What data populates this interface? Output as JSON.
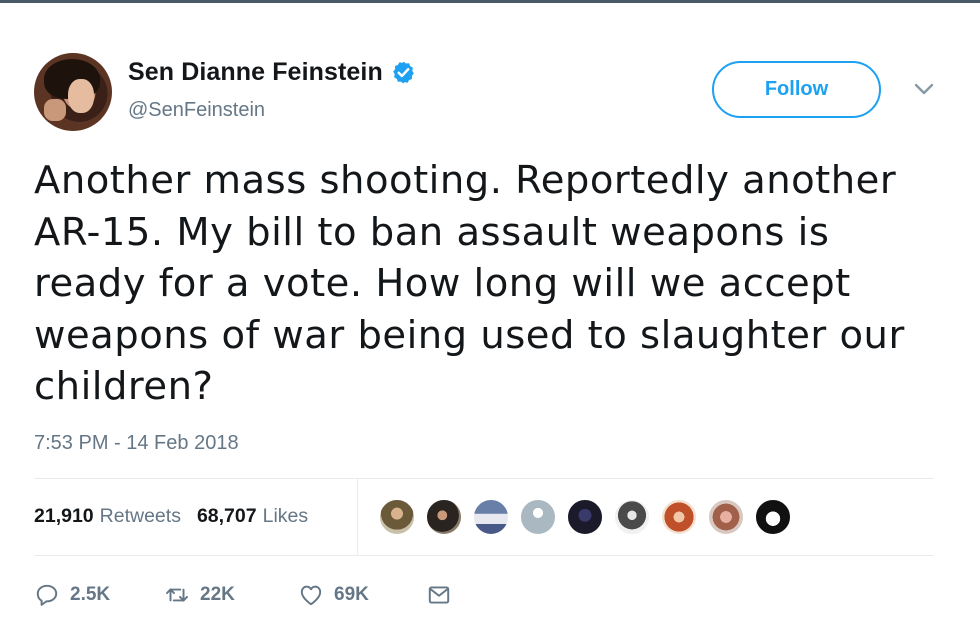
{
  "header": {
    "display_name": "Sen Dianne Feinstein",
    "handle": "@SenFeinstein",
    "follow_label": "Follow"
  },
  "tweet": {
    "text": "Another mass shooting. Reportedly another AR-15. My bill to ban assault weapons is ready for a vote. How long will we accept weapons of war being used to slaughter our children?",
    "timestamp": "7:53 PM - 14 Feb 2018"
  },
  "stats": {
    "retweets_count": "21,910",
    "retweets_label": "Retweets",
    "likes_count": "68,707",
    "likes_label": "Likes"
  },
  "likers": {
    "avatars": [
      "liker-avatar-1",
      "liker-avatar-2",
      "liker-avatar-3",
      "liker-avatar-4",
      "liker-avatar-5",
      "liker-avatar-6",
      "liker-avatar-7",
      "liker-avatar-8",
      "liker-avatar-9"
    ]
  },
  "actions": {
    "reply_count": "2.5K",
    "retweet_count": "22K",
    "like_count": "69K"
  },
  "colors": {
    "accent": "#1da1f2",
    "secondary_text": "#657786",
    "primary_text": "#14171a"
  },
  "icons": {
    "verified": "verified-badge-icon",
    "menu": "chevron-down-icon",
    "reply": "reply-icon",
    "retweet": "retweet-icon",
    "like": "heart-icon",
    "dm": "envelope-icon"
  }
}
